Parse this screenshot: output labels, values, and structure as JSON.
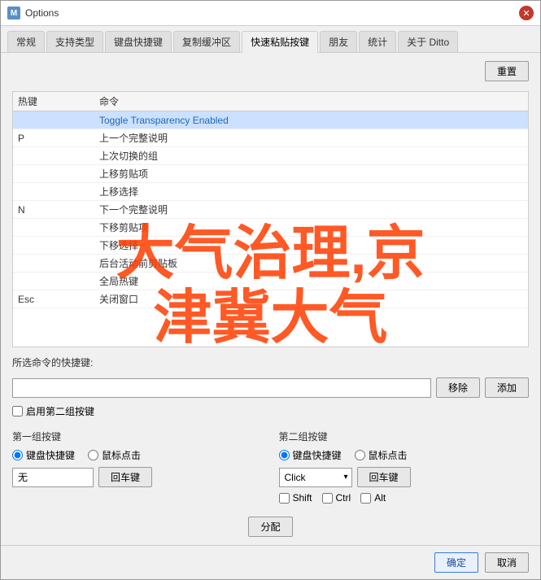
{
  "window": {
    "title": "Options",
    "icon": "M"
  },
  "tabs": [
    {
      "label": "常规",
      "active": false
    },
    {
      "label": "支持类型",
      "active": false
    },
    {
      "label": "键盘快捷键",
      "active": false
    },
    {
      "label": "复制缓冲区",
      "active": false
    },
    {
      "label": "快速粘贴按键",
      "active": true
    },
    {
      "label": "朋友",
      "active": false
    },
    {
      "label": "统计",
      "active": false
    },
    {
      "label": "关于 Ditto",
      "active": false
    }
  ],
  "toolbar": {
    "reset_label": "重置"
  },
  "table": {
    "col_hotkey": "热键",
    "col_command": "命令",
    "rows": [
      {
        "key": "",
        "cmd": "Toggle Transparency Enabled",
        "blue": true
      },
      {
        "key": "P",
        "cmd": "上一个完整说明",
        "blue": false
      },
      {
        "key": "",
        "cmd": "上次切换的组",
        "blue": false
      },
      {
        "key": "",
        "cmd": "上移剪贴项",
        "blue": false
      },
      {
        "key": "",
        "cmd": "上移选择",
        "blue": false
      },
      {
        "key": "N",
        "cmd": "下一个完整说明",
        "blue": false
      },
      {
        "key": "",
        "cmd": "下移剪贴项",
        "blue": false
      },
      {
        "key": "",
        "cmd": "下移选择",
        "blue": false
      },
      {
        "key": "",
        "cmd": "后台活动前剪贴板",
        "blue": false
      },
      {
        "key": "",
        "cmd": "全局热键",
        "blue": false
      },
      {
        "key": "Esc",
        "cmd": "关闭窗口",
        "blue": false
      }
    ]
  },
  "shortcut_section": {
    "label": "所选命令的快捷键:",
    "remove_label": "移除",
    "add_label": "添加",
    "enable_second_label": "启用第二组按键",
    "input_value": ""
  },
  "group1": {
    "title": "第一组按键",
    "radio1": "键盘快捷键",
    "radio2": "鼠标点击",
    "key_value": "无",
    "enter_label": "回车键"
  },
  "group2": {
    "title": "第二组按键",
    "radio1": "键盘快捷键",
    "radio2": "鼠标点击",
    "dropdown_value": "Click",
    "enter_label": "回车键",
    "shift_label": "Shift",
    "ctrl_label": "Ctrl",
    "alt_label": "Alt"
  },
  "assign_label": "分配",
  "bottom": {
    "ok_label": "确定",
    "cancel_label": "取消"
  },
  "watermark": {
    "line1": "大气治理,京",
    "line2": "津冀大气"
  }
}
